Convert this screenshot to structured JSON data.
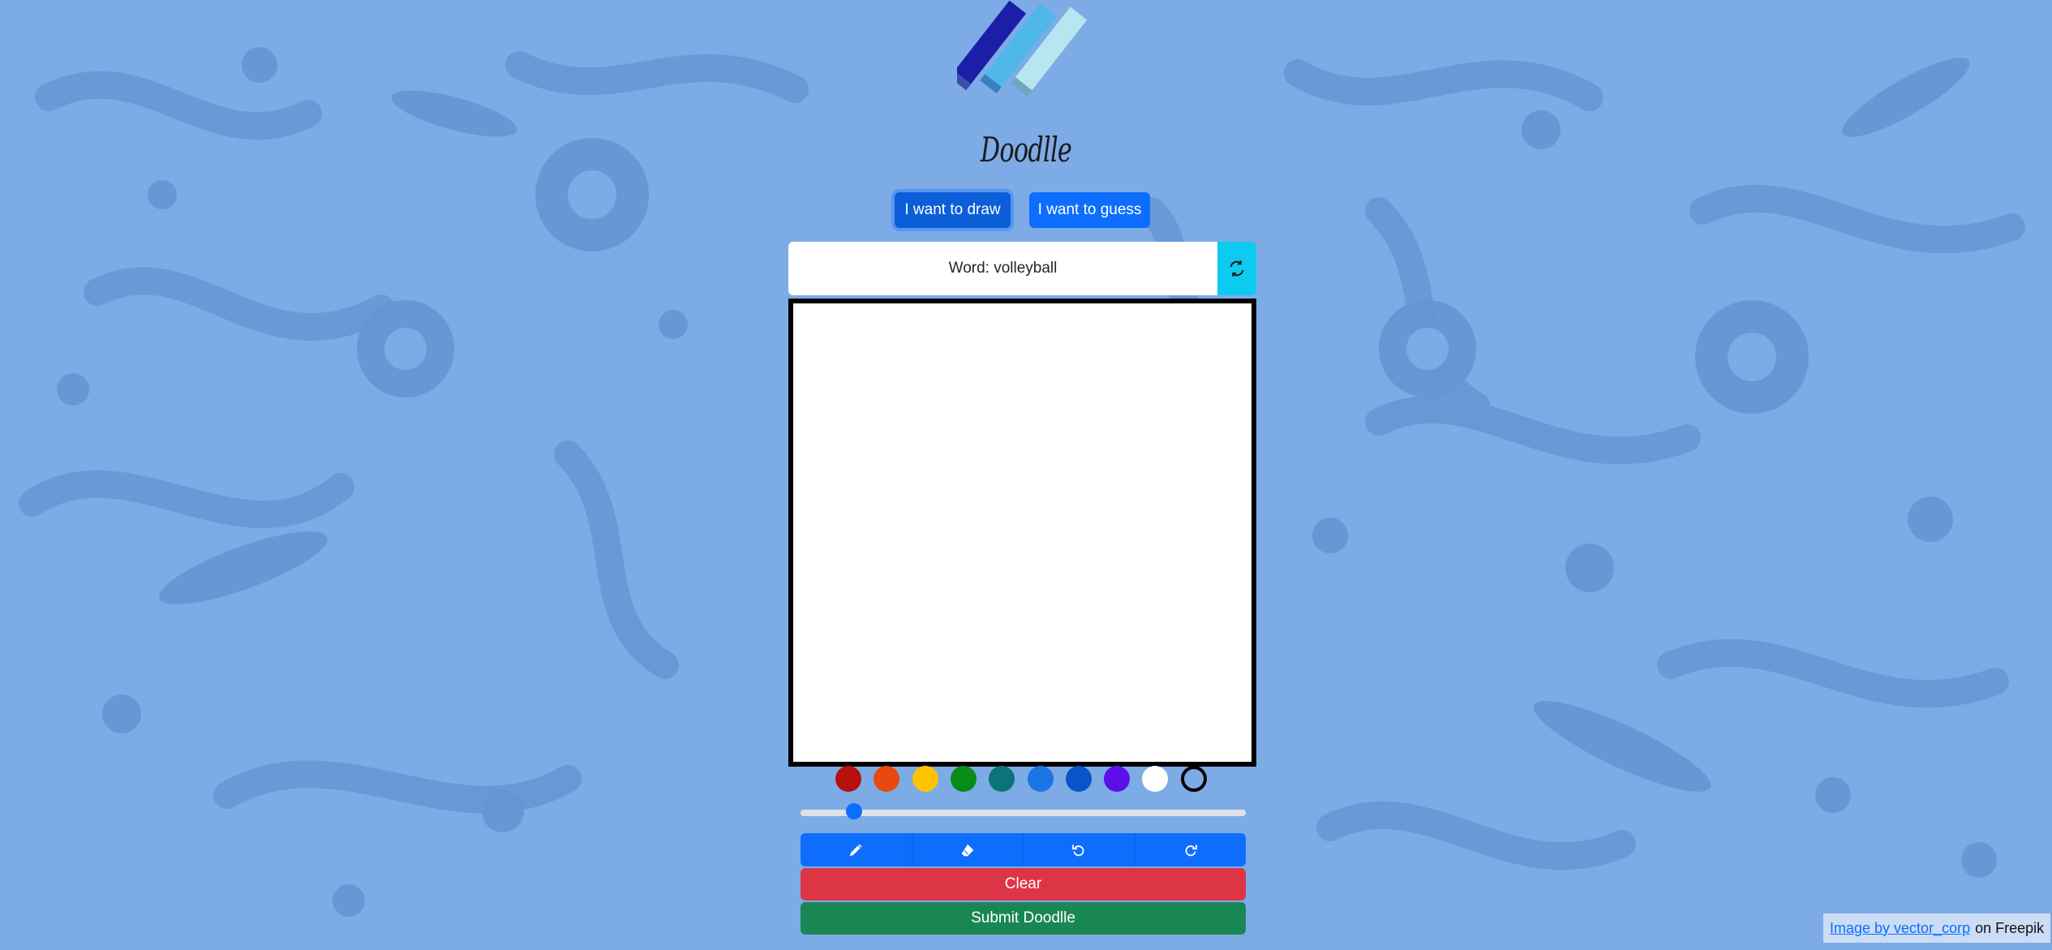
{
  "app": {
    "title": "Doodlle"
  },
  "modes": {
    "draw_label": "I want to draw",
    "guess_label": "I want to guess",
    "active": "draw"
  },
  "word": {
    "text": "Word: volleyball"
  },
  "icons": {
    "refresh": "refresh-icon",
    "pen": "pencil-icon",
    "eraser": "eraser-icon",
    "undo": "undo-icon",
    "redo": "redo-icon"
  },
  "palette": [
    {
      "name": "red",
      "color": "#b80f0f"
    },
    {
      "name": "orange",
      "color": "#e8490f"
    },
    {
      "name": "yellow",
      "color": "#ffc400"
    },
    {
      "name": "green",
      "color": "#078c18"
    },
    {
      "name": "teal",
      "color": "#0b7478"
    },
    {
      "name": "blue",
      "color": "#1b75e6"
    },
    {
      "name": "dark-blue",
      "color": "#0a54c9"
    },
    {
      "name": "violet",
      "color": "#5e0fe8"
    },
    {
      "name": "white",
      "color": "#ffffff"
    },
    {
      "name": "black-outline",
      "color": "#000000"
    }
  ],
  "brush_size": {
    "value_fraction": 0.12
  },
  "actions": {
    "clear_label": "Clear",
    "submit_label": "Submit Doodlle"
  },
  "credit": {
    "link_text": "Image by vector_corp",
    "suffix": "on Freepik"
  },
  "colors": {
    "background": "#7dabe6",
    "primary": "#0d6efd",
    "info": "#0dcaf0",
    "danger": "#dc3545",
    "success": "#198754"
  }
}
